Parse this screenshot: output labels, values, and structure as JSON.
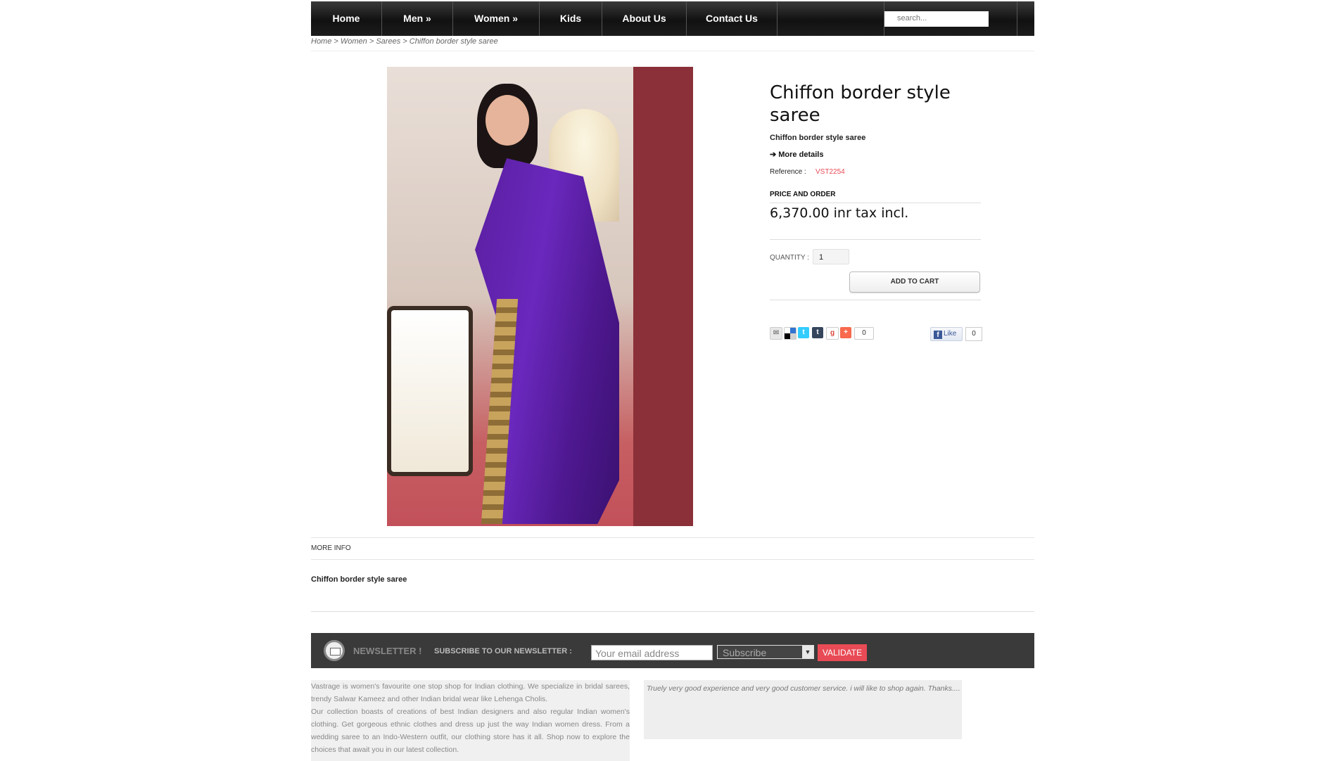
{
  "nav": {
    "items": [
      {
        "label": "Home"
      },
      {
        "label": "Men »"
      },
      {
        "label": "Women »"
      },
      {
        "label": "Kids"
      },
      {
        "label": "About Us"
      },
      {
        "label": "Contact Us"
      }
    ],
    "search_placeholder": "search..."
  },
  "breadcrumb": {
    "items": [
      "Home",
      "Women",
      "Sarees"
    ],
    "separator": " > ",
    "current": "Chiffon border style saree"
  },
  "product": {
    "title": "Chiffon border style saree",
    "short_description": "Chiffon border style saree",
    "more_details": "➔ More details",
    "reference_label": "Reference :",
    "reference_value": "VST2254",
    "price_heading": "PRICE AND ORDER",
    "price": "6,370.00 inr tax incl.",
    "quantity_label": "QUANTITY :",
    "quantity_value": "1",
    "add_to_cart": "ADD TO CART",
    "share_count": "0",
    "fb_like_label": "Like",
    "fb_like_count": "0"
  },
  "more_info": {
    "heading": "MORE INFO",
    "description": "Chiffon border style saree"
  },
  "newsletter": {
    "title": "NEWSLETTER !",
    "subtitle": "SUBSCRIBE TO OUR NEWSLETTER :",
    "email_placeholder": "Your email address",
    "select_value": "Subscribe",
    "validate": "VALIDATE"
  },
  "footer": {
    "about_p1": "Vastrage is women's favourite one stop shop for Indian clothing. We specialize in bridal sarees, trendy Salwar Kameez and other Indian bridal wear like Lehenga Cholis.",
    "about_p2": "Our collection boasts of creations of best Indian designers and also regular Indian women's clothing. Get gorgeous ethnic clothes and dress up just the way Indian women dress. From a wedding saree to an Indo-Western outfit, our clothing store has it all. Shop now to explore the choices that await you in our latest collection.",
    "testimonial": "Truely very good experience and very good customer service. i will like to shop again. Thanks...."
  },
  "colors": {
    "accent": "#e84b55",
    "nav_bg": "#1a1a1a",
    "newsletter_bg": "#3a3a3a"
  },
  "icons": [
    "search-icon",
    "email-icon",
    "delicious-icon",
    "twitter-icon",
    "tumblr-icon",
    "google-icon",
    "add-plus-icon",
    "facebook-icon",
    "mail-envelope-icon"
  ]
}
